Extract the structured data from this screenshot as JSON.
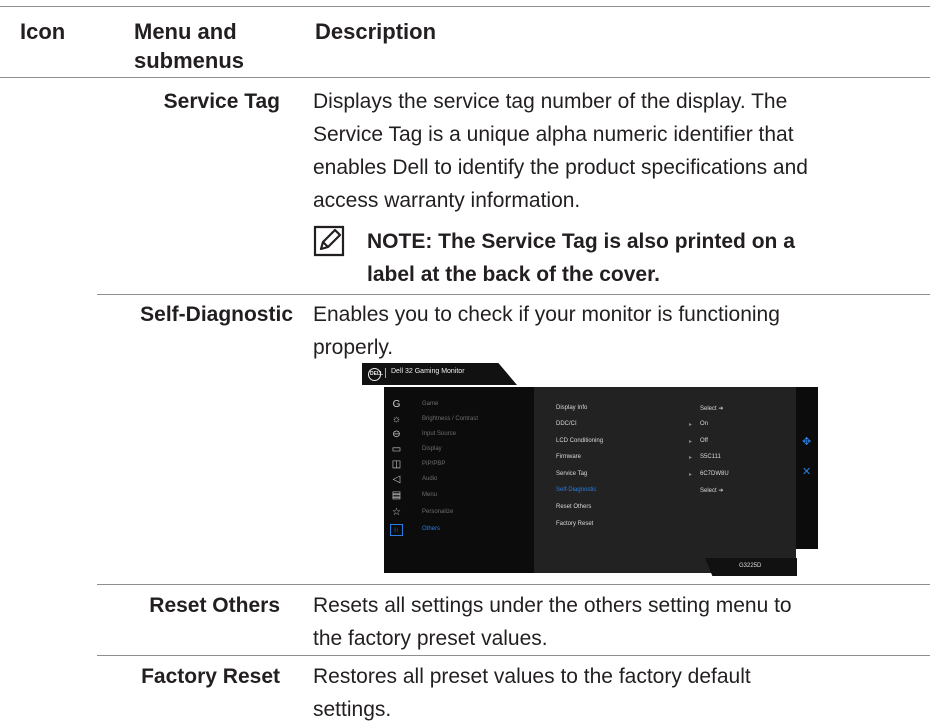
{
  "header": {
    "icon": "Icon",
    "menu_line1": "Menu and",
    "menu_line2": "submenus",
    "description": "Description"
  },
  "rows": [
    {
      "name": "Service Tag",
      "description": [
        "Displays the service tag number of the display. The",
        "Service Tag is a unique alpha numeric identifier that",
        "enables Dell to identify the product specifications and",
        "access warranty information."
      ],
      "note": [
        "NOTE: The Service Tag is also printed on a",
        "label at the back of the cover."
      ]
    },
    {
      "name": "Self-Diagnostic",
      "description": [
        "Enables you to check if your monitor is functioning",
        "properly."
      ]
    },
    {
      "name": "Reset Others",
      "description": [
        "Resets all settings under the others setting menu to",
        "the factory preset values."
      ]
    },
    {
      "name": "Factory Reset",
      "description": [
        "Restores all preset values to the factory default",
        "settings."
      ]
    }
  ],
  "osd": {
    "logo": "DELL",
    "title": "Dell 32 Gaming Monitor",
    "model": "G3225D",
    "menu": [
      {
        "label": "Game",
        "icon": "game-icon",
        "glyph": "G"
      },
      {
        "label": "Brightness / Contrast",
        "icon": "brightness-icon",
        "glyph": "☼"
      },
      {
        "label": "Input Source",
        "icon": "input-source-icon",
        "glyph": "⊖"
      },
      {
        "label": "Display",
        "icon": "display-icon",
        "glyph": "▭"
      },
      {
        "label": "PIP/PBP",
        "icon": "pip-pbp-icon",
        "glyph": "◫"
      },
      {
        "label": "Audio",
        "icon": "audio-icon",
        "glyph": "◁"
      },
      {
        "label": "Menu",
        "icon": "menu-icon",
        "glyph": "▤"
      },
      {
        "label": "Personalize",
        "icon": "personalize-icon",
        "glyph": "☆"
      },
      {
        "label": "Others",
        "icon": "others-icon",
        "glyph": "i↑",
        "active": true
      }
    ],
    "submenu": [
      {
        "label": "Display Info",
        "value": "Select",
        "suffix": "➔"
      },
      {
        "label": "DDC/CI",
        "value": "On",
        "arrow": "▸"
      },
      {
        "label": "LCD Conditioning",
        "value": "Off",
        "arrow": "▸"
      },
      {
        "label": "Firmware",
        "value": "S5C111",
        "arrow": "▸"
      },
      {
        "label": "Service Tag",
        "value": "6C7DW8U",
        "arrow": "▸"
      },
      {
        "label": "Self-Diagnostic",
        "value": "Select",
        "suffix": "➔",
        "active": true
      },
      {
        "label": "Reset Others",
        "value": ""
      },
      {
        "label": "Factory Reset",
        "value": ""
      }
    ],
    "nav": {
      "move_glyph": "✥",
      "close_glyph": "✕"
    }
  },
  "colors": {
    "accent": "#2a7de1",
    "rule": "#8e8e8e",
    "text": "#231f20"
  }
}
